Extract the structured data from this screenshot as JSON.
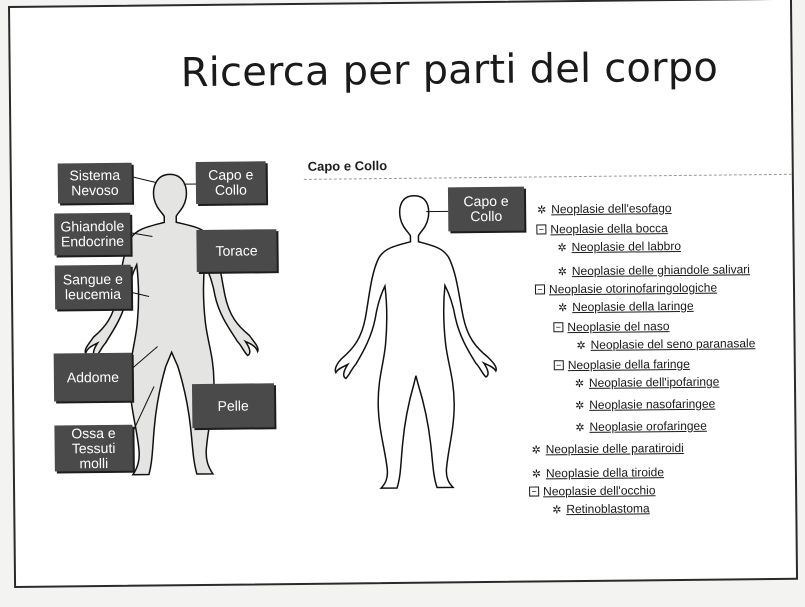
{
  "title": "Ricerca per parti del corpo",
  "left_labels": [
    {
      "text": "Sistema\nNevoso"
    },
    {
      "text": "Capo e\nCollo"
    },
    {
      "text": "Ghiandole\nEndocrine"
    },
    {
      "text": "Torace"
    },
    {
      "text": "Sangue e\nleucemia"
    },
    {
      "text": "Addome"
    },
    {
      "text": "Pelle"
    },
    {
      "text": "Ossa e\nTessuti molli"
    }
  ],
  "panel": {
    "title": "Capo e Collo",
    "label": "Capo e\nCollo"
  },
  "tree": [
    {
      "text": "Neoplasie dell'esofago",
      "icon": "leaf"
    },
    {
      "text": "Neoplasie della bocca",
      "icon": "collapse"
    },
    {
      "text": "Neoplasie del labbro",
      "icon": "leaf"
    },
    {
      "text": "Neoplasie delle ghiandole salivari",
      "icon": "leaf"
    },
    {
      "text": "Neoplasie otorinofaringologiche",
      "icon": "collapse"
    },
    {
      "text": "Neoplasie della laringe",
      "icon": "leaf"
    },
    {
      "text": "Neoplasie del naso",
      "icon": "collapse"
    },
    {
      "text": "Neoplasie del seno paranasale",
      "icon": "leaf"
    },
    {
      "text": "Neoplasie della faringe",
      "icon": "collapse"
    },
    {
      "text": "Neoplasie dell'ipofaringe",
      "icon": "leaf"
    },
    {
      "text": "Neoplasie nasofaringee",
      "icon": "leaf"
    },
    {
      "text": "Neoplasie orofaringee",
      "icon": "leaf"
    },
    {
      "text": "Neoplasie delle paratiroidi",
      "icon": "leaf"
    },
    {
      "text": "Neoplasie della tiroide",
      "icon": "leaf"
    },
    {
      "text": "Neoplasie dell'occhio",
      "icon": "collapse"
    },
    {
      "text": "Retinoblastoma",
      "icon": "leaf"
    }
  ],
  "colors": {
    "label_bg": "#4a4a4a",
    "label_text": "#ffffff",
    "body_fill": "#e4e4e2"
  }
}
